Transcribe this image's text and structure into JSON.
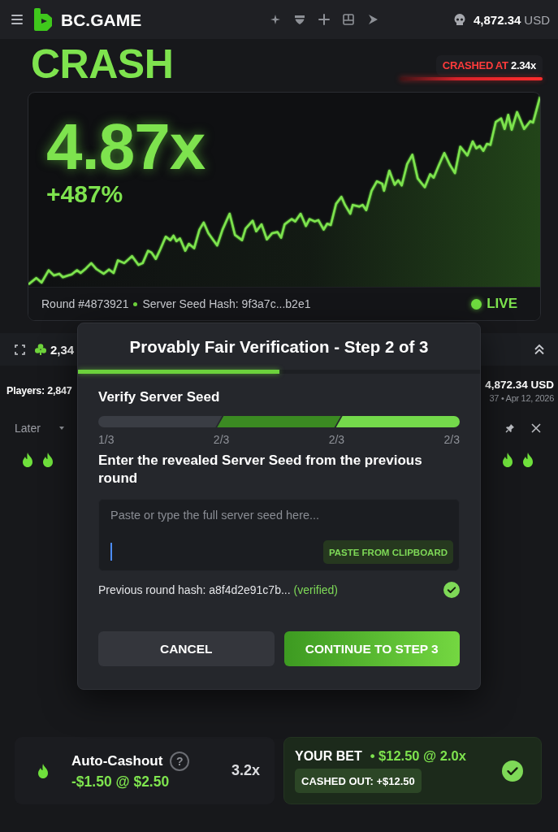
{
  "header": {
    "brand": "BC.GAME",
    "balance": "4,872.34",
    "currency": "USD"
  },
  "game": {
    "title": "CRASH",
    "last_crash": {
      "label": "CRASHED AT",
      "value": "2.34x"
    }
  },
  "chart": {
    "multiplier": "4.87x",
    "change": "+487%",
    "round": "Round #4873921",
    "seed_hash": "Server Seed Hash: 9f3a7c...b2e1",
    "status": "LIVE"
  },
  "ticker": {
    "value": "2,34"
  },
  "players": {
    "label": "Players: 2,847",
    "total": "4,872.34 USD",
    "meta": "37 • Apr 12, 2026"
  },
  "filter": {
    "label": "Later"
  },
  "modal": {
    "title": "Provably Fair Verification - Step 2 of 3",
    "level": 0.5,
    "heading": "Verify Server Seed",
    "segments": [
      {
        "color": "#3a3d44"
      },
      {
        "color": "#3b8a22"
      },
      {
        "color": "#74d94b"
      }
    ],
    "tick_labels": [
      "1/3",
      "2/3",
      "2/3",
      "2/3"
    ],
    "instruction": "Enter the revealed Server Seed from the previous round",
    "seed_input": {
      "placeholder": "Paste or type the full server seed here...",
      "focused": true
    },
    "paste_button": "PASTE FROM CLIPBOARD",
    "previous_hash": {
      "text": "Previous round hash: a8f4d2e91c7b...",
      "status": "(verified)",
      "verified": true
    },
    "buttons": [
      {
        "label": "CANCEL",
        "kind": "secondary"
      },
      {
        "label": "CONTINUE TO STEP 3",
        "kind": "primary"
      }
    ]
  },
  "auto_cashout": {
    "label": "Auto-Cashout",
    "help": "?",
    "value": "-$1.50 @ $2.50",
    "multiplier": "3.2x"
  },
  "your_bet": {
    "label": "YOUR BET",
    "amount": "• $12.50 @ 2.0x",
    "cashed_out": "CASHED OUT: +$12.50",
    "settled": true
  }
}
